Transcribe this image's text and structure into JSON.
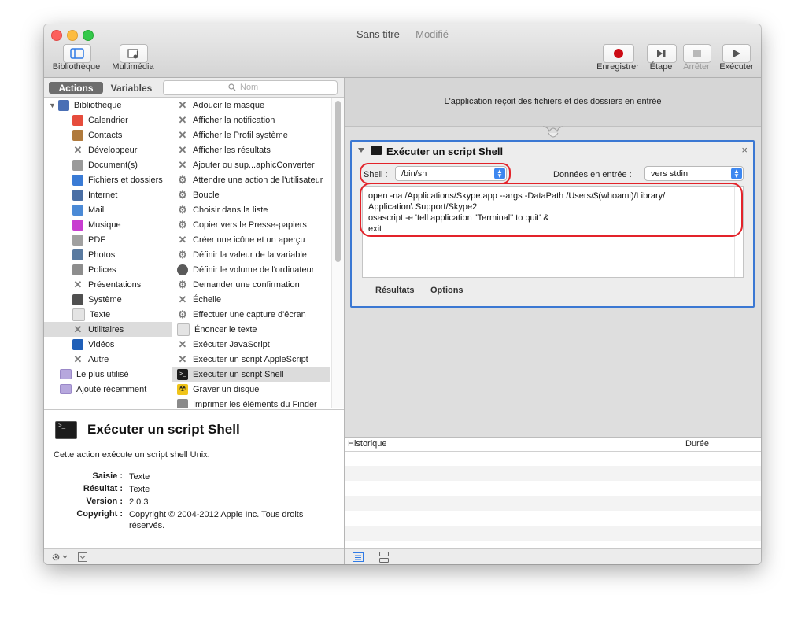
{
  "window": {
    "title": "Sans titre",
    "title_sep": " — ",
    "modified": "Modifié"
  },
  "toolbar": {
    "left": [
      {
        "label": "Bibliothèque",
        "icon": "library-panel-icon"
      },
      {
        "label": "Multimédia",
        "icon": "media-icon"
      }
    ],
    "right": [
      {
        "label": "Enregistrer",
        "icon": "record-icon",
        "color": "#d0021b"
      },
      {
        "label": "Étape",
        "icon": "step-icon"
      },
      {
        "label": "Arrêter",
        "icon": "stop-icon",
        "disabled": true
      },
      {
        "label": "Exécuter",
        "icon": "play-icon"
      }
    ]
  },
  "left_header": {
    "tab_actions": "Actions",
    "tab_variables": "Variables",
    "search_placeholder": "Nom"
  },
  "library": {
    "root": "Bibliothèque",
    "items": [
      {
        "label": "Calendrier",
        "icon": "calendar-icon",
        "color": "#e64c3c"
      },
      {
        "label": "Contacts",
        "icon": "contacts-icon",
        "color": "#b07a3c"
      },
      {
        "label": "Développeur",
        "icon": "tools-icon"
      },
      {
        "label": "Document(s)",
        "icon": "document-icon",
        "color": "#9a9a9a"
      },
      {
        "label": "Fichiers et dossiers",
        "icon": "finder-icon",
        "color": "#3a7bd5"
      },
      {
        "label": "Internet",
        "icon": "globe-icon",
        "color": "#4a6fa5"
      },
      {
        "label": "Mail",
        "icon": "mail-icon",
        "color": "#4b8ad6"
      },
      {
        "label": "Musique",
        "icon": "music-icon",
        "color": "#c83dd0"
      },
      {
        "label": "PDF",
        "icon": "pdf-icon",
        "color": "#a0a0a0"
      },
      {
        "label": "Photos",
        "icon": "photos-icon",
        "color": "#5a7aa0"
      },
      {
        "label": "Polices",
        "icon": "fonts-icon",
        "color": "#8d8d8d"
      },
      {
        "label": "Présentations",
        "icon": "tools-icon"
      },
      {
        "label": "Système",
        "icon": "system-icon",
        "color": "#505050"
      },
      {
        "label": "Texte",
        "icon": "text-icon",
        "color": "#c9c9c9"
      },
      {
        "label": "Utilitaires",
        "icon": "tools-icon",
        "selected": true
      },
      {
        "label": "Vidéos",
        "icon": "quicktime-icon",
        "color": "#1f5fb8"
      },
      {
        "label": "Autre",
        "icon": "tools-icon"
      }
    ],
    "smart": [
      {
        "label": "Le plus utilisé",
        "icon": "smart-folder-icon"
      },
      {
        "label": "Ajouté récemment",
        "icon": "smart-folder-icon"
      }
    ]
  },
  "actions": [
    {
      "label": "Adoucir le masque",
      "icon": "tools-icon"
    },
    {
      "label": "Afficher la notification",
      "icon": "tools-icon"
    },
    {
      "label": "Afficher le Profil système",
      "icon": "tools-icon"
    },
    {
      "label": "Afficher les résultats",
      "icon": "tools-icon"
    },
    {
      "label": "Ajouter ou sup...aphicConverter",
      "icon": "tools-icon"
    },
    {
      "label": "Attendre une action de l'utilisateur",
      "icon": "robot-icon"
    },
    {
      "label": "Boucle",
      "icon": "robot-icon"
    },
    {
      "label": "Choisir dans la liste",
      "icon": "robot-icon"
    },
    {
      "label": "Copier vers le Presse-papiers",
      "icon": "robot-icon"
    },
    {
      "label": "Créer une icône et un aperçu",
      "icon": "tools-icon"
    },
    {
      "label": "Définir la valeur de la variable",
      "icon": "robot-icon"
    },
    {
      "label": "Définir le volume de l'ordinateur",
      "icon": "volume-icon"
    },
    {
      "label": "Demander une confirmation",
      "icon": "robot-icon"
    },
    {
      "label": "Échelle",
      "icon": "tools-icon"
    },
    {
      "label": "Effectuer une capture d'écran",
      "icon": "robot-icon"
    },
    {
      "label": "Énoncer le texte",
      "icon": "text-icon"
    },
    {
      "label": "Exécuter JavaScript",
      "icon": "tools-icon"
    },
    {
      "label": "Exécuter un script AppleScript",
      "icon": "tools-icon"
    },
    {
      "label": "Exécuter un script Shell",
      "icon": "terminal-icon",
      "selected": true
    },
    {
      "label": "Graver un disque",
      "icon": "burn-icon"
    },
    {
      "label": "Imprimer les éléments du Finder",
      "icon": "finder-icon"
    }
  ],
  "description": {
    "title": "Exécuter un script Shell",
    "text": "Cette action exécute un script shell Unix.",
    "meta": [
      {
        "key": "Saisie :",
        "value": "Texte"
      },
      {
        "key": "Résultat :",
        "value": "Texte"
      },
      {
        "key": "Version :",
        "value": "2.0.3"
      },
      {
        "key": "Copyright :",
        "value": "Copyright © 2004-2012 Apple Inc. Tous droits réservés."
      }
    ]
  },
  "workflow": {
    "input_text": "L'application reçoit des fichiers et des dossiers en entrée",
    "action_title": "Exécuter un script Shell",
    "close": "×",
    "shell_label": "Shell :",
    "shell_value": "/bin/sh",
    "input_label": "Données en entrée :",
    "input_value": "vers stdin",
    "script_lines": [
      "open -na /Applications/Skype.app --args -DataPath /Users/$(whoami)/Library/",
      "Application\\ Support/Skype2",
      "osascript -e 'tell application \"Terminal\" to quit' &",
      "exit"
    ],
    "tab_results": "Résultats",
    "tab_options": "Options",
    "accent": "#3b78d3",
    "highlight": "#e3232a"
  },
  "history": {
    "col_history": "Historique",
    "col_duration": "Durée"
  }
}
